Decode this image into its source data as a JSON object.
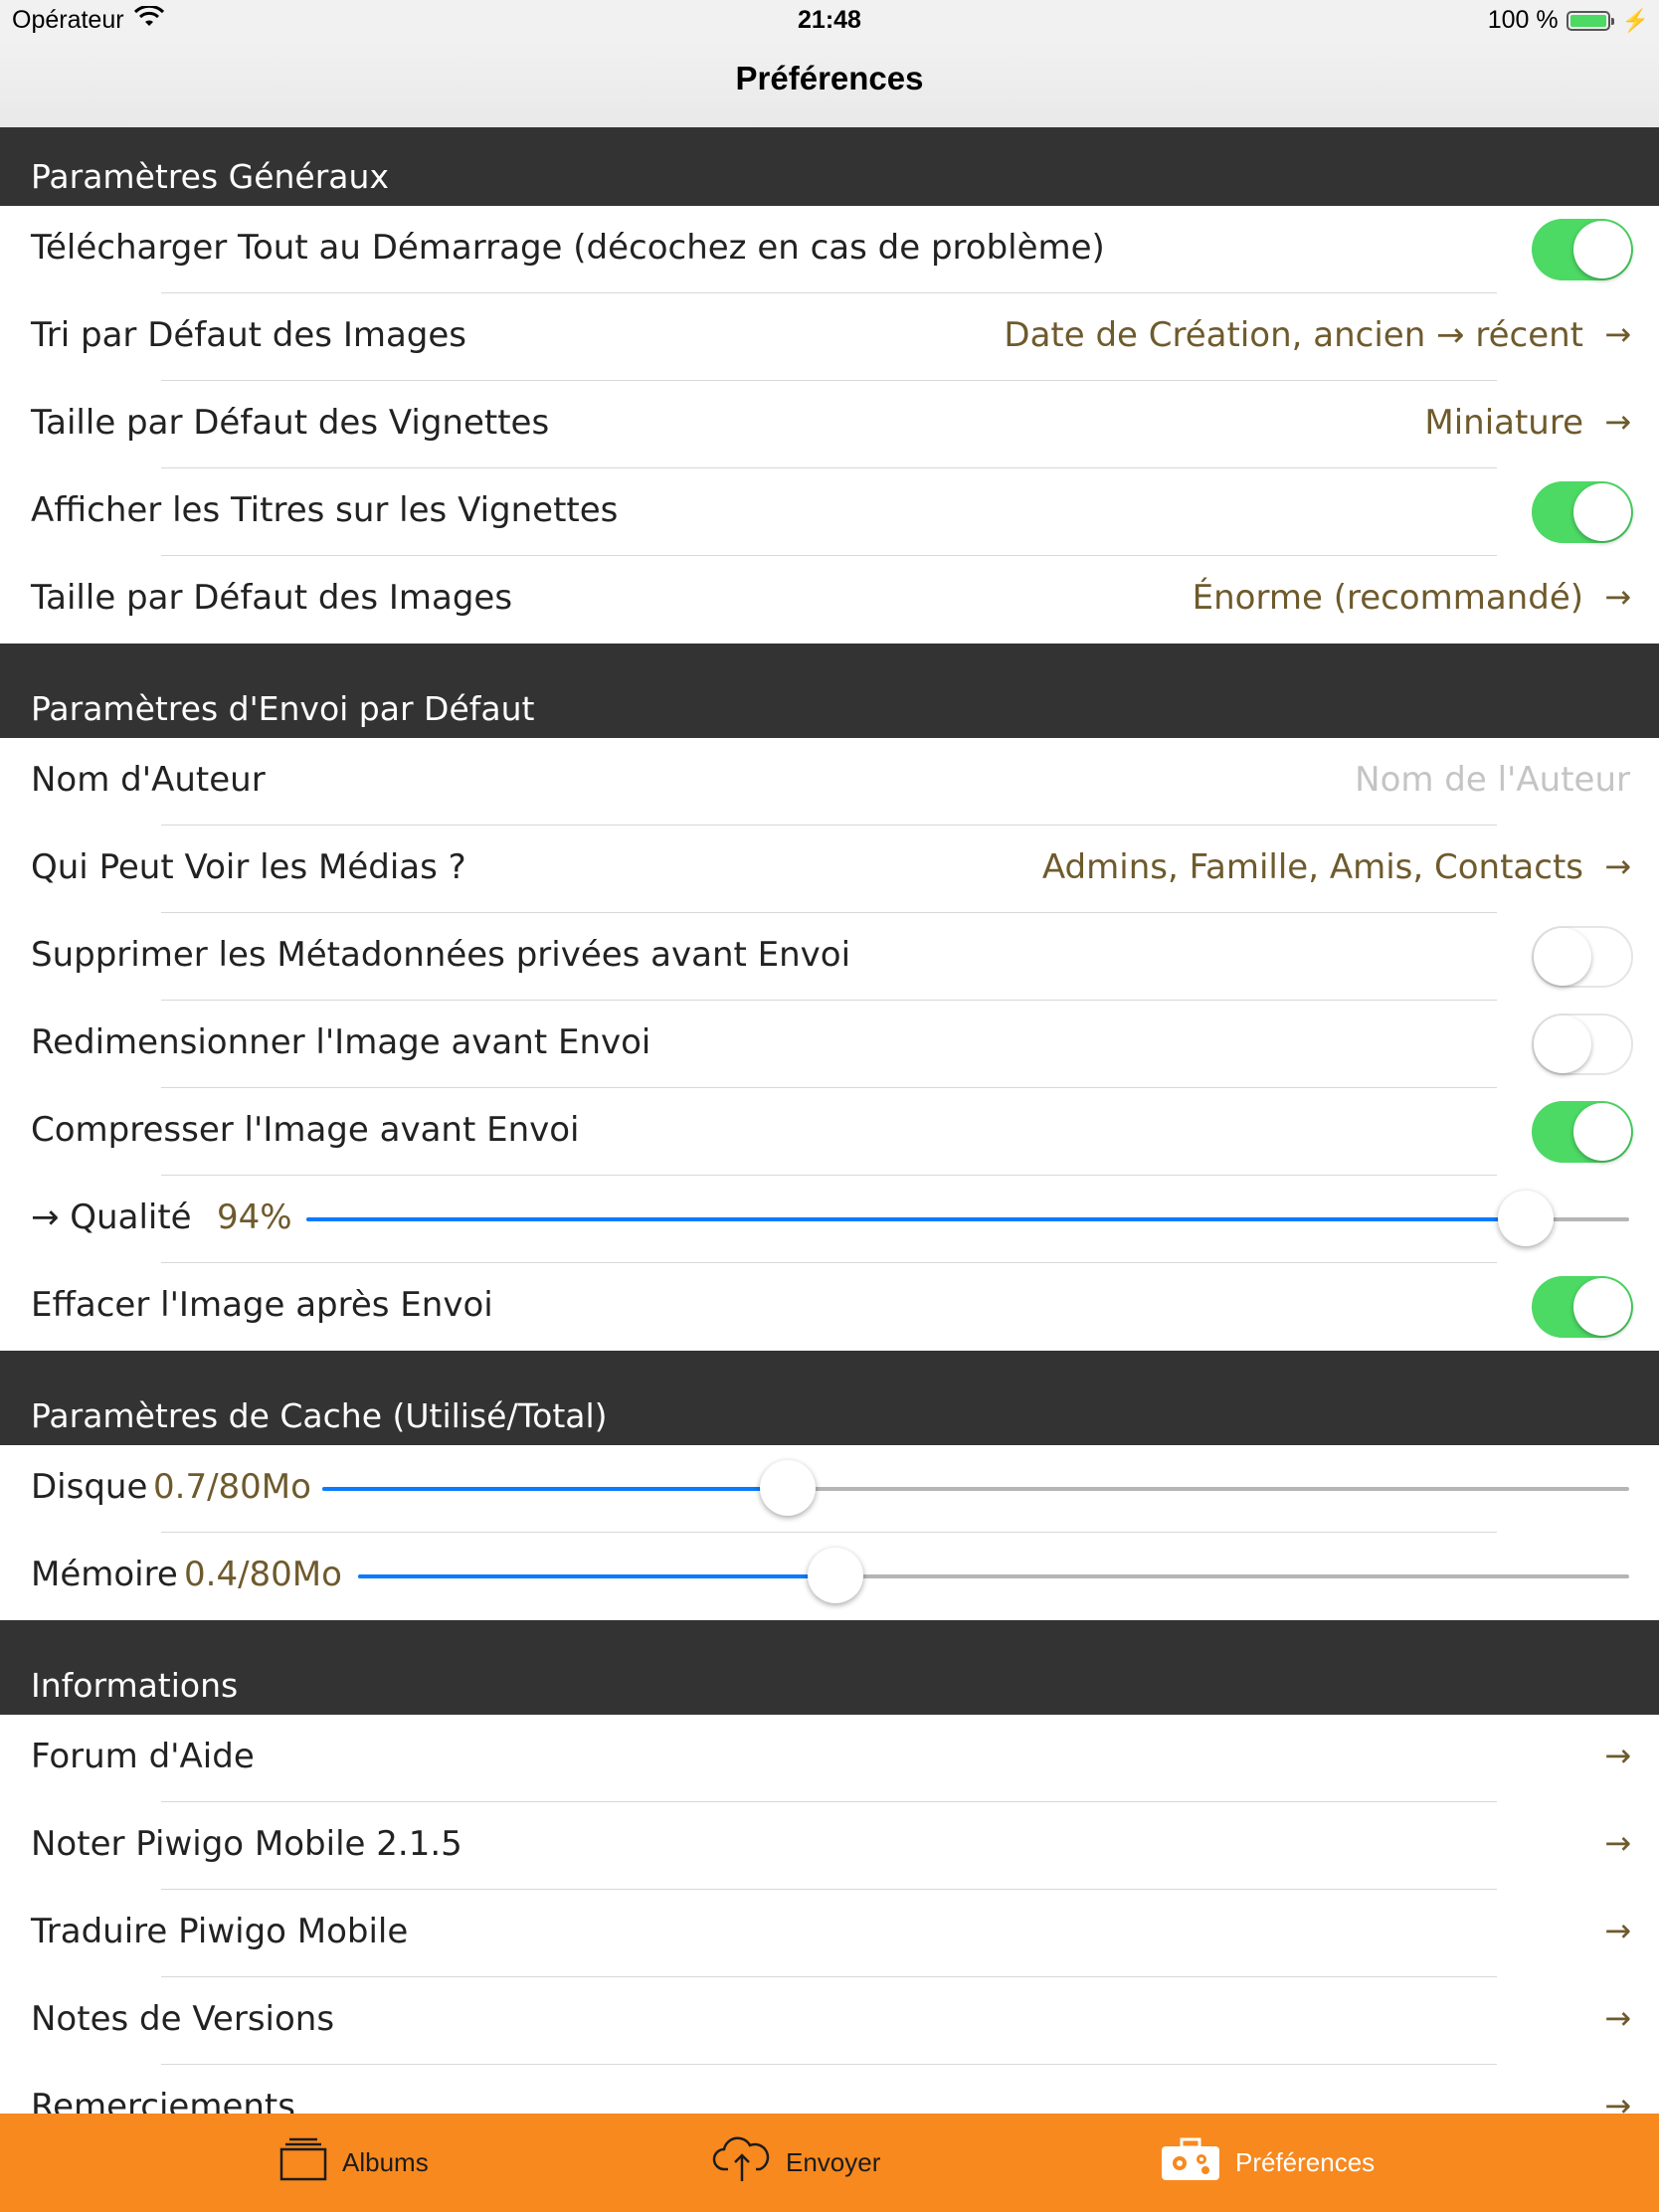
{
  "status_bar": {
    "carrier": "Opérateur",
    "time": "21:48",
    "battery": "100 %",
    "battery_level": 1.0
  },
  "nav": {
    "title": "Préférences"
  },
  "sections": {
    "general": {
      "header": "Paramètres Généraux",
      "download_all": {
        "label": "Télécharger Tout au Démarrage (décochez en cas de problème)",
        "on": true
      },
      "image_sort": {
        "label": "Tri par Défaut des Images",
        "value": "Date de Création, ancien → récent"
      },
      "thumb_size": {
        "label": "Taille par Défaut des Vignettes",
        "value": "Miniature"
      },
      "show_titles": {
        "label": "Afficher les Titres sur les Vignettes",
        "on": true
      },
      "image_size": {
        "label": "Taille par Défaut des Images",
        "value": "Énorme (recommandé)"
      }
    },
    "upload": {
      "header": "Paramètres d'Envoi par Défaut",
      "author": {
        "label": "Nom d'Auteur",
        "placeholder": "Nom de l'Auteur",
        "value": ""
      },
      "privacy": {
        "label": "Qui Peut Voir les Médias ?",
        "value": "Admins, Famille, Amis, Contacts"
      },
      "strip_metadata": {
        "label": "Supprimer les Métadonnées privées avant Envoi",
        "on": false
      },
      "resize": {
        "label": "Redimensionner l'Image avant Envoi",
        "on": false
      },
      "compress": {
        "label": "Compresser l'Image avant Envoi",
        "on": true
      },
      "quality": {
        "label": "→ Qualité",
        "value": "94%",
        "level": 0.94
      },
      "delete_after": {
        "label": "Effacer l'Image après Envoi",
        "on": true
      }
    },
    "cache": {
      "header": "Paramètres de Cache (Utilisé/Total)",
      "disk": {
        "label": "Disque",
        "value": "0.7/80Mo",
        "level": 0.35
      },
      "memory": {
        "label": "Mémoire",
        "value": "0.4/80Mo",
        "level": 0.37
      }
    },
    "info": {
      "header": "Informations",
      "items": [
        "Forum d'Aide",
        "Noter Piwigo Mobile 2.1.5",
        "Traduire Piwigo Mobile",
        "Notes de Versions",
        "Remerciements"
      ],
      "chevron": "→"
    }
  },
  "tab_bar": {
    "tabs": [
      {
        "label": "Albums",
        "icon": "albums-icon"
      },
      {
        "label": "Envoyer",
        "icon": "upload-cloud-icon"
      },
      {
        "label": "Préférences",
        "icon": "settings-toolbox-icon",
        "active": true
      }
    ],
    "colors": {
      "background": "#f7891f",
      "active_label": "#ffffff"
    }
  },
  "colors": {
    "section_header": "#333333",
    "value_text": "#6e5a2c",
    "toggle_on": "#4cd964",
    "slider_fill": "#0a7aff"
  }
}
